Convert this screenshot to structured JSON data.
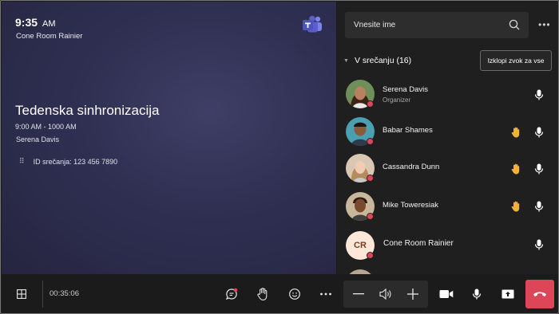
{
  "stage": {
    "time": "9:35",
    "ampm": "AM",
    "room": "Cone Room Rainier",
    "meeting_title": "Tedenska sinhronizacija",
    "meeting_time_start": "9:00",
    "meeting_time_rest": "AM - 1000 AM",
    "organizer": "Serena Davis",
    "dial_glyph": "⠿",
    "meeting_id": "ID srečanja: 123 456 7890"
  },
  "panel": {
    "search_placeholder": "Vnesite ime",
    "section_label": "V srečanju (16)",
    "mute_all_label": "Izklopi zvok za vse",
    "more_glyph": "•••",
    "participants": [
      {
        "name": "Serena Davis",
        "role": "Organizer",
        "hand": false
      },
      {
        "name": "Babar Shames",
        "role": "",
        "hand": true
      },
      {
        "name": "Cassandra Dunn",
        "role": "",
        "hand": true
      },
      {
        "name": "Mike Toweresiak",
        "role": "",
        "hand": true
      },
      {
        "name": "Cone Room Rainier",
        "role": "",
        "hand": false,
        "initials": "CR"
      }
    ]
  },
  "bottombar": {
    "timer": "00:35:06"
  },
  "colors": {
    "hangup": "#dd4659",
    "presence_dot": "#e0445a",
    "hand": "#f2b233",
    "teams": "#5b5fc7"
  }
}
